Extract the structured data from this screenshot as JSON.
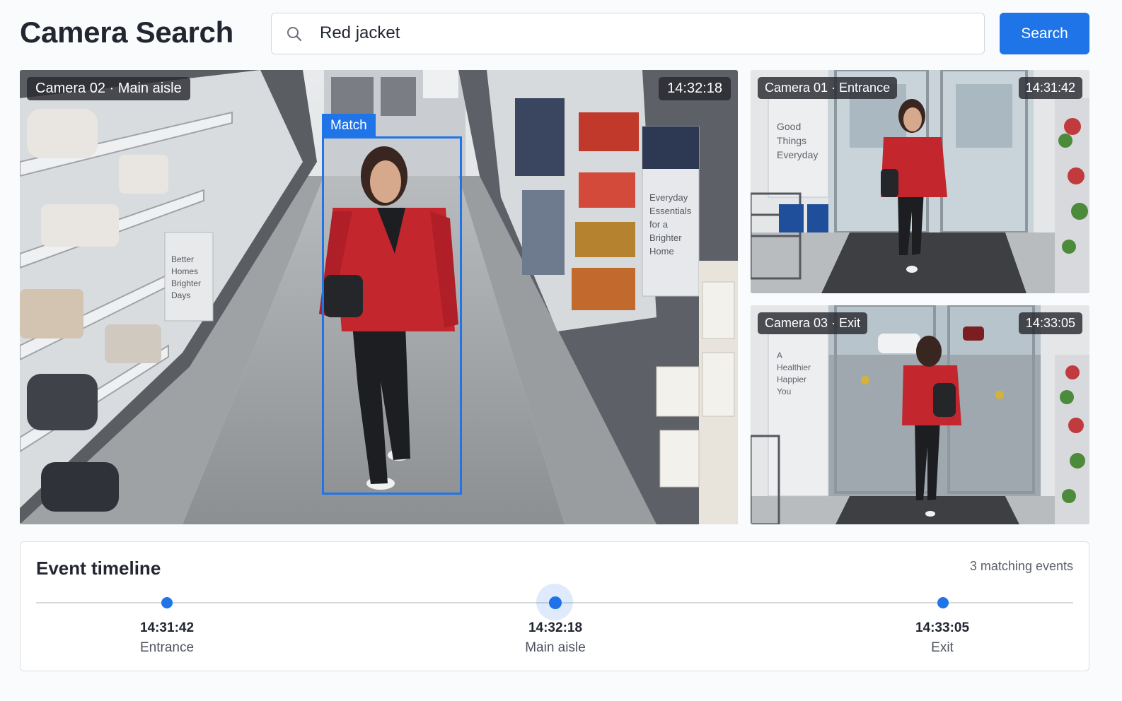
{
  "header": {
    "title": "Camera Search",
    "search": {
      "value": "Red jacket",
      "icon": "search-icon"
    },
    "search_button_label": "Search"
  },
  "feeds": {
    "main": {
      "camera_label": "Camera 02 · Main aisle",
      "timestamp": "14:32:18",
      "match_label": "Match",
      "signs": [
        "Better",
        "Homes",
        "Brighter",
        "Days",
        "Everyday",
        "Essentials",
        "for a",
        "Brighter",
        "Home"
      ]
    },
    "cam1": {
      "camera_label": "Camera 01 · Entrance",
      "timestamp": "14:31:42",
      "signs": [
        "Good",
        "Things",
        "Everyday"
      ]
    },
    "cam3": {
      "camera_label": "Camera 03 · Exit",
      "timestamp": "14:33:05",
      "signs": [
        "A",
        "Healthier",
        "Happier",
        "You"
      ]
    }
  },
  "timeline": {
    "title": "Event timeline",
    "count_label": "3 matching events",
    "events": [
      {
        "time": "14:31:42",
        "place": "Entrance",
        "active": false
      },
      {
        "time": "14:32:18",
        "place": "Main aisle",
        "active": true
      },
      {
        "time": "14:33:05",
        "place": "Exit",
        "active": false
      }
    ]
  },
  "colors": {
    "accent": "#1f74e8",
    "jacket": "#c4262e"
  }
}
